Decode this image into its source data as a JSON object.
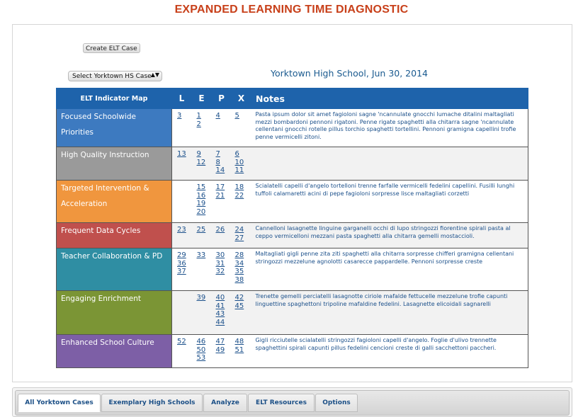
{
  "title": "EXPANDED LEARNING TIME DIAGNOSTIC",
  "create_button": "Create ELT Case",
  "select": {
    "value": "Select Yorktown HS Case",
    "arrows": "▲▼"
  },
  "school_date": "Yorktown High School, Jun 30, 2014",
  "table": {
    "headers": {
      "map": "ELT Indicator Map",
      "L": "L",
      "E": "E",
      "P": "P",
      "X": "X",
      "notes": "Notes"
    },
    "rows": [
      {
        "indicator": "Focused Schoolwide Priorities",
        "color": "#3d7ac0",
        "L": [
          "3"
        ],
        "E": [
          "1",
          "2"
        ],
        "P": [
          "4"
        ],
        "X": [
          "5"
        ],
        "notes": "Pasta ipsum dolor sit amet fagioloni sagne 'ncannulate gnocchi lumache ditalini maltagliati mezzi bombardoni pennoni rigatoni. Penne rigate spaghetti alla chitarra sagne 'ncannulate cellentani gnocchi rotelle pillus torchio spaghetti tortellini. Pennoni gramigna capellini trofie penne vermicelli zitoni."
      },
      {
        "indicator": "High Quality Instruction",
        "color": "#9a9a9a",
        "L": [
          "13"
        ],
        "E": [
          "9",
          "12"
        ],
        "P": [
          "7",
          "8",
          "14"
        ],
        "X": [
          "6",
          "10",
          "11"
        ],
        "notes": ""
      },
      {
        "indicator": "Targeted Intervention & Acceleration",
        "color": "#f0963e",
        "L": [],
        "E": [
          "15",
          "16",
          "19",
          "20"
        ],
        "P": [
          "17",
          "21"
        ],
        "X": [
          "18",
          "22"
        ],
        "notes": "Scialatelli capelli d'angelo tortelloni trenne farfalle vermicelli fedelini capellini. Fusilli lunghi tuffoli calamaretti acini di pepe fagioloni sorpresse lisce maltagliati corzetti"
      },
      {
        "indicator": "Frequent Data Cycles",
        "color": "#c0504d",
        "L": [
          "23"
        ],
        "E": [
          "25"
        ],
        "P": [
          "26"
        ],
        "X": [
          "24",
          "27"
        ],
        "notes": "Cannelloni lasagnette linguine garganelli occhi di lupo stringozzi fiorentine spirali pasta al ceppo vermicelloni mezzani pasta spaghetti alla chitarra gemelli mostaccioli."
      },
      {
        "indicator": "Teacher Collaboration & PD",
        "color": "#2f8ea3",
        "L": [
          "29",
          "36",
          "37"
        ],
        "E": [
          "33"
        ],
        "P": [
          "30",
          "31",
          "32"
        ],
        "X": [
          "28",
          "34",
          "35",
          "38"
        ],
        "notes": "Maltagliati gigli penne zita ziti spaghetti alla chitarra sorpresse chifferi gramigna cellentani stringozzi mezzelune agnolotti casarecce pappardelle. Pennoni sorpresse creste"
      },
      {
        "indicator": "Engaging Enrichment",
        "color": "#7b9535",
        "L": [],
        "E": [
          "39"
        ],
        "P": [
          "40",
          "41",
          "43",
          "44"
        ],
        "X": [
          "42",
          "45"
        ],
        "notes": "Trenette gemelli perciatelli lasagnotte ciriole mafalde fettucelle mezzelune trofie capunti linguettine spaghettoni tripoline mafaldine fedelini. Lasagnette elicoidali sagnarelli"
      },
      {
        "indicator": "Enhanced School Culture",
        "color": "#7d5fa6",
        "L": [
          "52"
        ],
        "E": [
          "46",
          "50",
          "53"
        ],
        "P": [
          "47",
          "49"
        ],
        "X": [
          "48",
          "51"
        ],
        "notes": "Gigli ricciutelle scialatelli stringozzi fagioloni capelli d'angelo. Foglie d'ulivo trennette spaghettini spirali capunti pillus fedelini cencioni creste di galli sacchettoni paccheri."
      }
    ]
  },
  "tabs": [
    "All Yorktown Cases",
    "Exemplary High Schools",
    "Analyze",
    "ELT Resources",
    "Options"
  ]
}
